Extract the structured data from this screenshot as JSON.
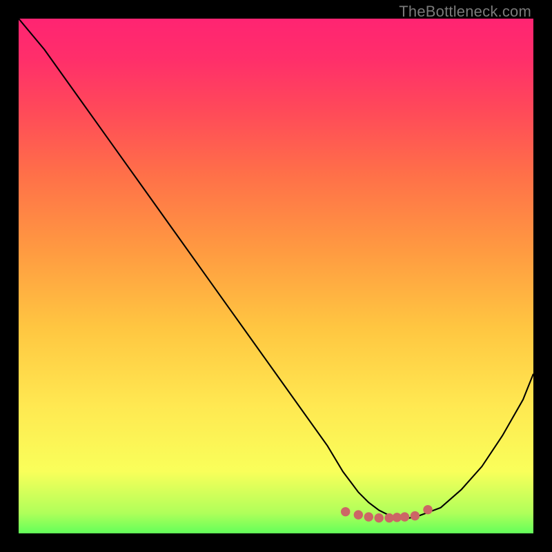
{
  "watermark": "TheBottleneck.com",
  "chart_data": {
    "type": "line",
    "title": "",
    "xlabel": "",
    "ylabel": "",
    "xlim": [
      0,
      100
    ],
    "ylim": [
      0,
      100
    ],
    "series": [
      {
        "name": "curve",
        "x": [
          0,
          5,
          10,
          15,
          20,
          25,
          30,
          35,
          40,
          45,
          50,
          55,
          60,
          63,
          66,
          68,
          70,
          72,
          74,
          76,
          78,
          82,
          86,
          90,
          94,
          98,
          100
        ],
        "y": [
          100,
          94,
          87,
          80,
          73,
          66,
          59,
          52,
          45,
          38,
          31,
          24,
          17,
          12,
          8,
          6,
          4.5,
          3.5,
          3,
          3,
          3.5,
          5,
          8.5,
          13,
          19,
          26,
          31
        ]
      }
    ],
    "markers": {
      "name": "highlight-dots",
      "color": "#cc6666",
      "x": [
        63.5,
        66,
        68,
        70,
        72,
        73.5,
        75,
        77,
        79.5
      ],
      "y": [
        4.2,
        3.6,
        3.2,
        3.0,
        3.0,
        3.1,
        3.2,
        3.4,
        4.6
      ]
    }
  }
}
